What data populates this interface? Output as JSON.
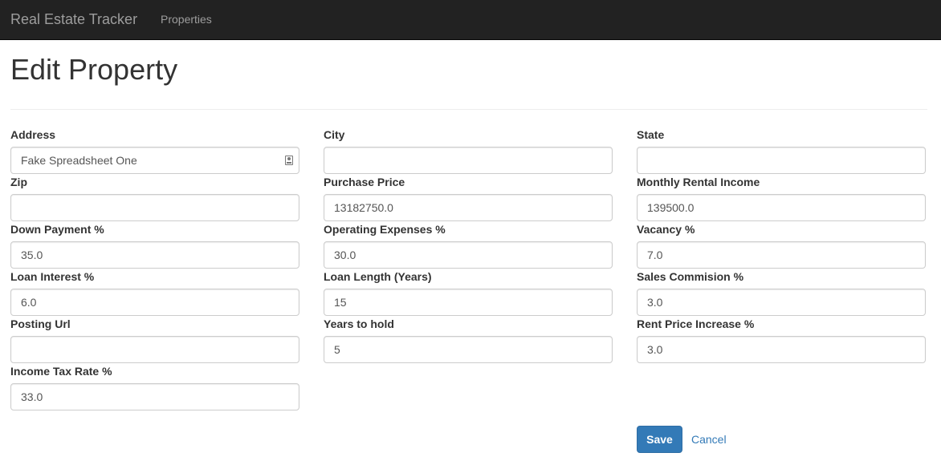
{
  "navbar": {
    "brand": "Real Estate Tracker",
    "links": [
      {
        "label": "Properties"
      }
    ]
  },
  "page": {
    "title": "Edit Property"
  },
  "fields": {
    "address": {
      "label": "Address",
      "value": "Fake Spreadsheet One",
      "icon": "contact-card-icon"
    },
    "city": {
      "label": "City",
      "value": ""
    },
    "state": {
      "label": "State",
      "value": ""
    },
    "zip": {
      "label": "Zip",
      "value": ""
    },
    "purchase_price": {
      "label": "Purchase Price",
      "value": "13182750.0"
    },
    "monthly_rental_income": {
      "label": "Monthly Rental Income",
      "value": "139500.0"
    },
    "down_payment": {
      "label": "Down Payment %",
      "value": "35.0"
    },
    "operating_expenses": {
      "label": "Operating Expenses %",
      "value": "30.0"
    },
    "vacancy": {
      "label": "Vacancy %",
      "value": "7.0"
    },
    "loan_interest": {
      "label": "Loan Interest %",
      "value": "6.0"
    },
    "loan_length": {
      "label": "Loan Length (Years)",
      "value": "15"
    },
    "sales_commission": {
      "label": "Sales Commision %",
      "value": "3.0"
    },
    "posting_url": {
      "label": "Posting Url",
      "value": ""
    },
    "years_to_hold": {
      "label": "Years to hold",
      "value": "5"
    },
    "rent_price_increase": {
      "label": "Rent Price Increase %",
      "value": "3.0"
    },
    "income_tax_rate": {
      "label": "Income Tax Rate %",
      "value": "33.0"
    }
  },
  "actions": {
    "save_label": "Save",
    "cancel_label": "Cancel"
  },
  "colors": {
    "navbar_bg": "#222222",
    "primary": "#337ab7"
  }
}
